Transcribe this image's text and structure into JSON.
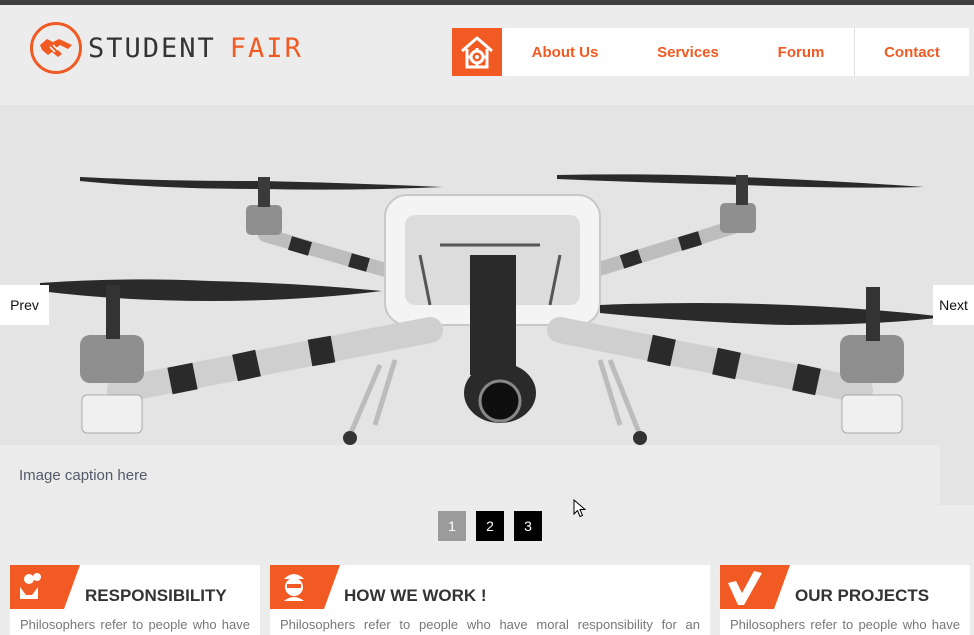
{
  "header": {
    "logo_word1": "STUDENT",
    "logo_word2": "FAIR",
    "nav": [
      {
        "label": "About Us"
      },
      {
        "label": "Services"
      },
      {
        "label": "Forum"
      },
      {
        "label": "Contact"
      }
    ]
  },
  "slider": {
    "caption": "Image caption here",
    "prev_label": "Prev",
    "next_label": "Next",
    "pages": [
      "1",
      "2",
      "3"
    ],
    "active_page": "1"
  },
  "cards": [
    {
      "title": "RESPONSIBILITY",
      "text": "Philosophers refer to people who have",
      "icon": "hands-heart-icon"
    },
    {
      "title": "HOW WE WORK !",
      "text": "Philosophers refer to people who have moral responsibility for an",
      "icon": "worker-face-icon"
    },
    {
      "title": "OUR PROJECTS",
      "text": "Philosophers refer to people who have",
      "icon": "checkmark-icon"
    }
  ],
  "colors": {
    "accent": "#f15a22",
    "topbar": "#3f3f3f",
    "background": "#ececec"
  }
}
